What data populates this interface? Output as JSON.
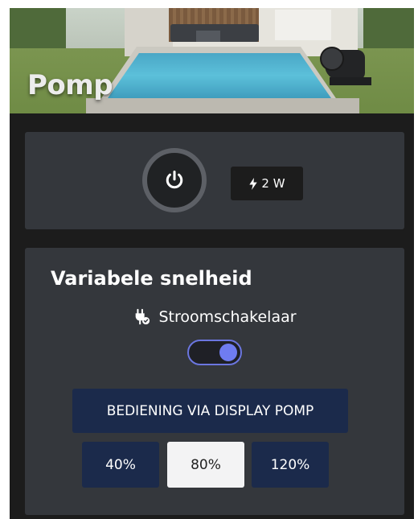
{
  "header": {
    "title": "Pomp"
  },
  "power": {
    "button_icon": "power-icon",
    "energy_icon": "lightning-icon",
    "energy_label": "2 W"
  },
  "speed": {
    "title": "Variabele snelheid",
    "switch_icon": "plug-icon",
    "switch_label": "Stroomschakelaar",
    "switch_on": true,
    "display_button_label": "BEDIENING VIA DISPLAY POMP",
    "percent_buttons": [
      {
        "label": "40%",
        "active": false
      },
      {
        "label": "80%",
        "active": true
      },
      {
        "label": "120%",
        "active": false
      }
    ]
  },
  "colors": {
    "background": "#1c1c1c",
    "card": "#34373c",
    "button": "#1b2a4b",
    "active_button": "#f3f3f4",
    "accent": "#6f7cf0"
  }
}
